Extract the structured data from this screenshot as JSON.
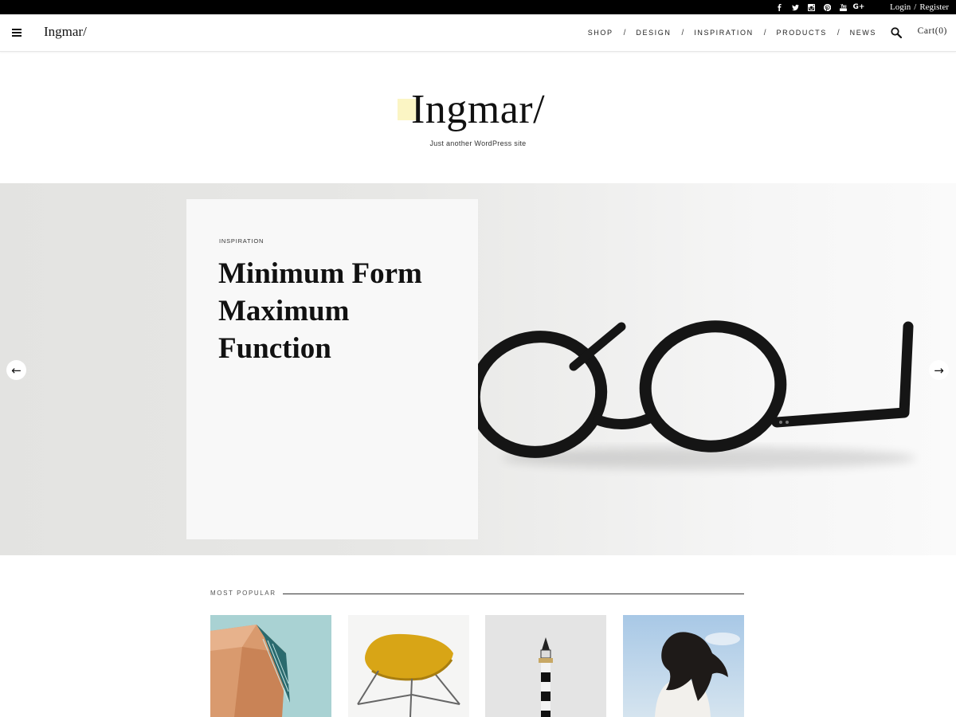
{
  "topbar": {
    "social_icons": [
      "facebook-icon",
      "twitter-icon",
      "instagram-icon",
      "pinterest-icon",
      "youtube-icon",
      "google-plus-icon"
    ],
    "google_plus_label": "G+",
    "login": "Login",
    "separator": "/",
    "register": "Register"
  },
  "header": {
    "brand": "Ingmar/",
    "nav": [
      {
        "label": "SHOP"
      },
      {
        "label": "DESIGN"
      },
      {
        "label": "INSPIRATION"
      },
      {
        "label": "PRODUCTS"
      },
      {
        "label": "NEWS"
      }
    ],
    "nav_separator": "/",
    "cart": "Cart(0)"
  },
  "site": {
    "title": "Ingmar/",
    "tagline": "Just another WordPress site",
    "highlight_color": "#fbf5c4"
  },
  "hero": {
    "category": "INSPIRATION",
    "title": "Minimum Form Maximum Function",
    "prev_arrow": "←",
    "next_arrow": "→"
  },
  "popular": {
    "label": "MOST POPULAR",
    "items": [
      {
        "image": "building-facade-image"
      },
      {
        "image": "yellow-stool-image"
      },
      {
        "image": "lighthouse-tower-image"
      },
      {
        "image": "woman-hair-sky-image"
      }
    ]
  },
  "colors": {
    "topbar": "#000000",
    "accent_highlight": "#fbf5c4",
    "text": "#111111"
  }
}
